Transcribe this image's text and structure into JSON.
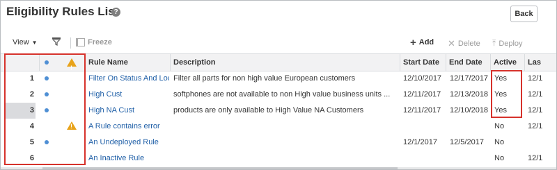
{
  "header": {
    "title": "Eligibility Rules List",
    "help_icon": "?",
    "back_label": "Back"
  },
  "toolbar": {
    "view_label": "View",
    "freeze_label": "Freeze",
    "add_label": "Add",
    "delete_label": "Delete",
    "deploy_label": "Deploy"
  },
  "table": {
    "columns": [
      "Rule Name",
      "Description",
      "Start Date",
      "End Date",
      "Active",
      "Las"
    ],
    "rows": [
      {
        "num": "1",
        "status_dot": true,
        "warning": false,
        "rule_name": "Filter On Status And Loc",
        "description": "Filter all parts for non high value European customers",
        "start_date": "12/10/2017",
        "end_date": "12/17/2017",
        "active": "Yes",
        "last": "12/1"
      },
      {
        "num": "2",
        "status_dot": true,
        "warning": false,
        "rule_name": "High Cust",
        "description": "softphones are not available to non High value business units ...",
        "start_date": "12/11/2017",
        "end_date": "12/13/2018",
        "active": "Yes",
        "last": "12/1"
      },
      {
        "num": "3",
        "status_dot": true,
        "warning": false,
        "rule_name": "High NA Cust",
        "description": "products are only available to High Value NA Customers",
        "start_date": "12/11/2017",
        "end_date": "12/10/2018",
        "active": "Yes",
        "last": "12/1"
      },
      {
        "num": "4",
        "status_dot": false,
        "warning": true,
        "rule_name": "A Rule contains error",
        "description": "",
        "start_date": "",
        "end_date": "",
        "active": "No",
        "last": "12/1"
      },
      {
        "num": "5",
        "status_dot": true,
        "warning": false,
        "rule_name": "An Undeployed Rule",
        "description": "",
        "start_date": "12/1/2017",
        "end_date": "12/5/2017",
        "active": "No",
        "last": ""
      },
      {
        "num": "6",
        "status_dot": false,
        "warning": false,
        "rule_name": "An Inactive Rule",
        "description": "",
        "start_date": "",
        "end_date": "",
        "active": "No",
        "last": "12/1"
      }
    ],
    "selected_row": "3"
  },
  "colors": {
    "link": "#1f5fa7",
    "status_dot": "#4f8fd4",
    "warning": "#e8a31a",
    "highlight_box": "#d6322b"
  }
}
